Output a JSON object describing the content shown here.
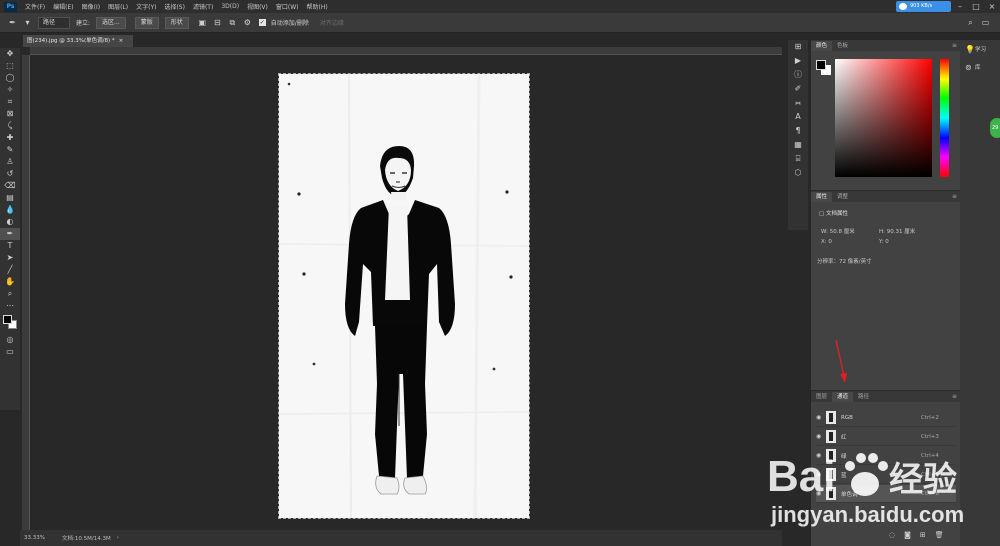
{
  "app": {
    "logo": "Ps"
  },
  "menus": [
    "文件(F)",
    "编辑(E)",
    "图像(I)",
    "图层(L)",
    "文字(Y)",
    "选择(S)",
    "滤镜(T)",
    "3D(D)",
    "视图(V)",
    "窗口(W)",
    "帮助(H)"
  ],
  "baidu_pill": {
    "label": "903 KB/s"
  },
  "options": {
    "mode": "路径",
    "make_label": "建立:",
    "selection_btn": "选区...",
    "mask_btn": "蒙版",
    "shape_btn": "形状",
    "auto_add": "自动添加/删除",
    "align_edges": "对齐边缘"
  },
  "document": {
    "tab_title": "图(234).jpg @ 33.3%(单色调/8) *",
    "zoom": "33.33%",
    "doc_info": "文档:10.5M/14.3M"
  },
  "colors": {
    "accent": "#31a8ff",
    "arrow": "#e02020",
    "fg": "#000000",
    "bg": "#ffffff"
  },
  "color_panel": {
    "tabs": [
      "颜色",
      "色板"
    ]
  },
  "properties_panel": {
    "tabs": [
      "属性",
      "调整"
    ],
    "heading": "文档属性",
    "w_label": "W:",
    "w_value": "50.8 厘米",
    "h_label": "H:",
    "h_value": "90.31 厘米",
    "x_label": "X:",
    "x_value": "0",
    "y_label": "Y:",
    "y_value": "0",
    "resolution": "分辨率：72 像素/英寸"
  },
  "channels_panel": {
    "tabs": [
      "图层",
      "通道",
      "路径"
    ],
    "rows": [
      {
        "name": "RGB",
        "shortcut": "Ctrl+2"
      },
      {
        "name": "红",
        "shortcut": "Ctrl+3"
      },
      {
        "name": "绿",
        "shortcut": "Ctrl+4"
      },
      {
        "name": "蓝",
        "shortcut": "Ctrl+5"
      },
      {
        "name": "单色调",
        "shortcut": "Ctrl+6"
      }
    ]
  },
  "side_dock": {
    "learn": "学习",
    "library": "库"
  },
  "watermark": {
    "brand": "Bai",
    "brand2": "经验",
    "url": "jingyan.baidu.com"
  },
  "badge": {
    "label": "29"
  }
}
